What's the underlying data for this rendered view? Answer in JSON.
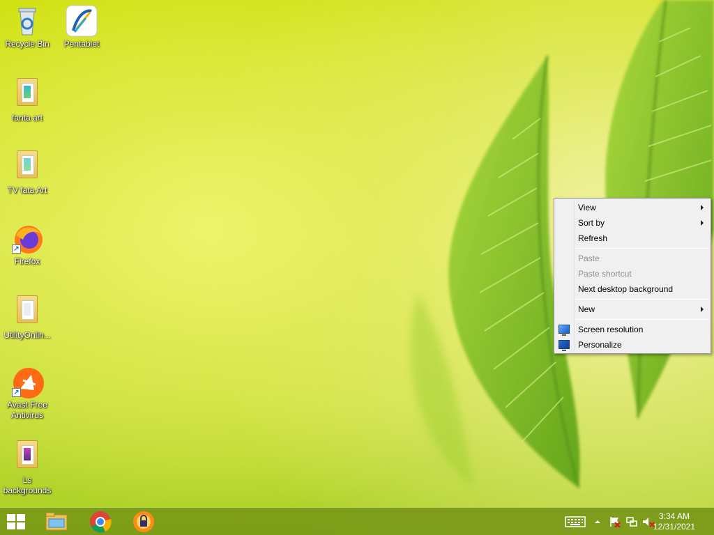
{
  "desktop": {
    "icons": [
      {
        "label": "Recycle Bin",
        "icon": "recycle-bin-icon"
      },
      {
        "label": "Pentablet",
        "icon": "pentablet-icon"
      },
      {
        "label": "fanta art",
        "icon": "folder-icon"
      },
      {
        "label": "TV fata Art",
        "icon": "folder-icon"
      },
      {
        "label": "Firefox",
        "icon": "firefox-icon"
      },
      {
        "label": "UtilityOnlin...",
        "icon": "folder-icon"
      },
      {
        "label": "Avast Free Antivirus",
        "icon": "avast-icon"
      },
      {
        "label": "Ls backgrounds",
        "icon": "folder-icon"
      }
    ]
  },
  "context_menu": {
    "items": [
      {
        "label": "View",
        "submenu": true,
        "enabled": true
      },
      {
        "label": "Sort by",
        "submenu": true,
        "enabled": true
      },
      {
        "label": "Refresh",
        "submenu": false,
        "enabled": true
      },
      {
        "label": "Paste",
        "submenu": false,
        "enabled": false
      },
      {
        "label": "Paste shortcut",
        "submenu": false,
        "enabled": false
      },
      {
        "label": "Next desktop background",
        "submenu": false,
        "enabled": true
      },
      {
        "label": "New",
        "submenu": true,
        "enabled": true
      },
      {
        "label": "Screen resolution",
        "submenu": false,
        "enabled": true,
        "icon": "monitor-icon"
      },
      {
        "label": "Personalize",
        "submenu": false,
        "enabled": true,
        "icon": "personalize-icon"
      }
    ]
  },
  "taskbar": {
    "pinned": [
      {
        "name": "start-button",
        "icon": "windows-logo-icon"
      },
      {
        "name": "file-explorer",
        "icon": "file-explorer-icon"
      },
      {
        "name": "chrome",
        "icon": "chrome-icon"
      },
      {
        "name": "avast-secure-browser",
        "icon": "avast-browser-icon"
      }
    ],
    "tray": {
      "icons": [
        "keyboard-icon",
        "show-hidden-icons-chevron",
        "action-center-flag-icon",
        "network-icon",
        "volume-muted-icon"
      ]
    },
    "clock": {
      "time": "3:34 AM",
      "date": "12/31/2021"
    }
  },
  "colors": {
    "taskbar": "#7a9818",
    "wallpaper_base": "#d4e42a",
    "leaf": "#7fbf22"
  }
}
